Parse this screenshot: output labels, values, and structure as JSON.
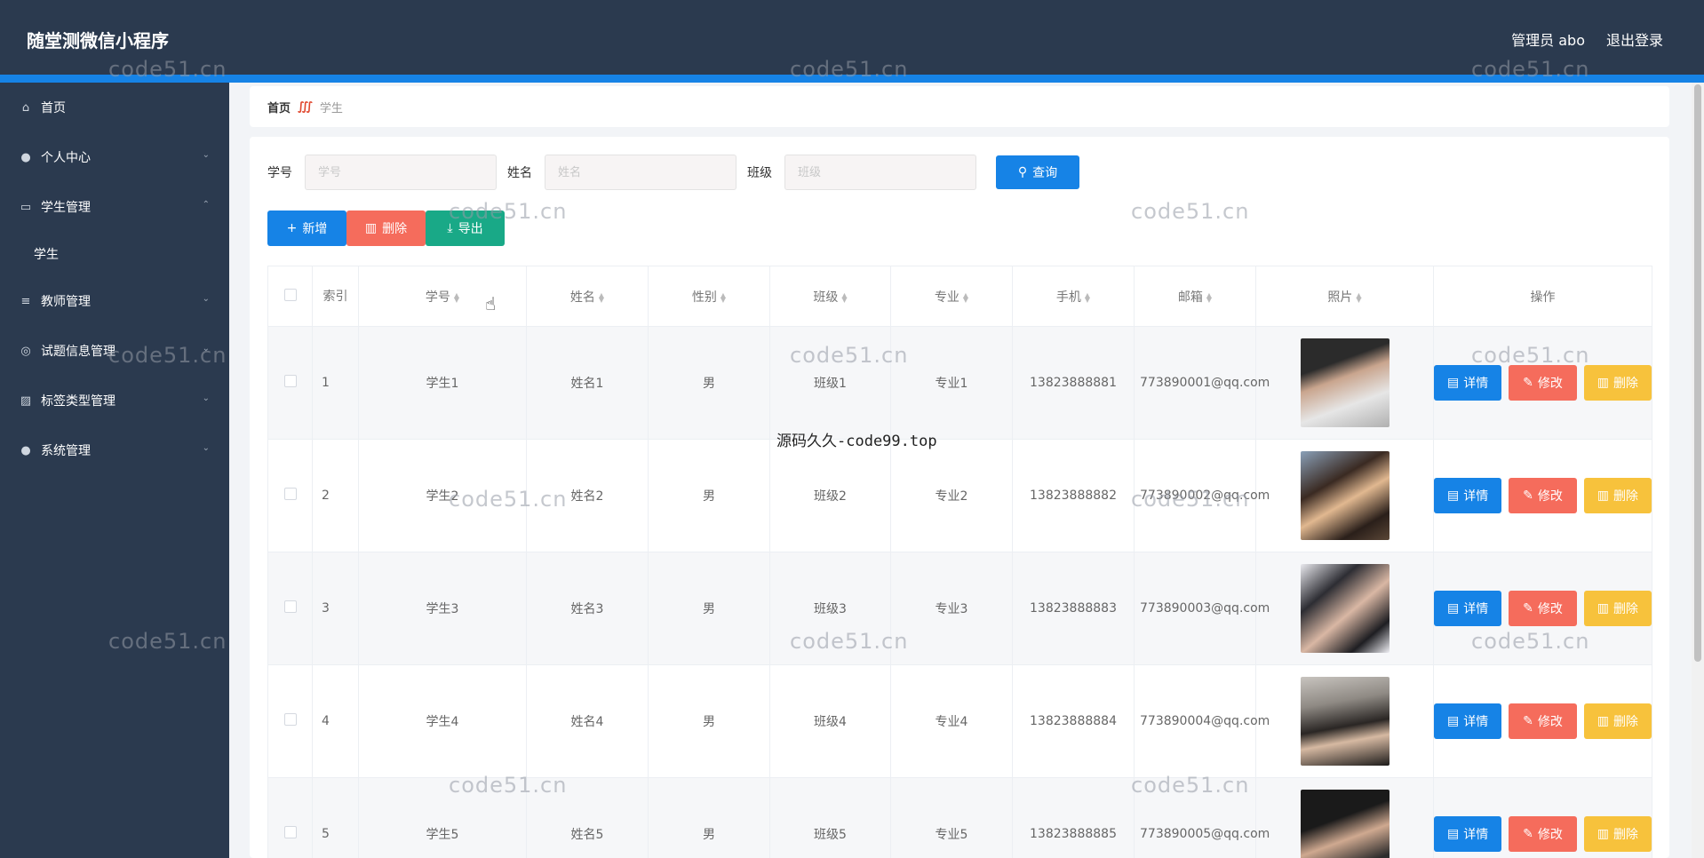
{
  "header": {
    "title": "随堂测微信小程序",
    "admin": "管理员 abo",
    "logout": "退出登录"
  },
  "sidebar": {
    "items": [
      {
        "label": "首页",
        "icon": "home-icon",
        "glyph": "⌂"
      },
      {
        "label": "个人中心",
        "icon": "user-icon",
        "glyph": "●",
        "chevron": "⌄"
      },
      {
        "label": "学生管理",
        "icon": "message-icon",
        "glyph": "▭",
        "chevron": "⌃"
      },
      {
        "label": "教师管理",
        "icon": "list-icon",
        "glyph": "≡",
        "chevron": "⌄"
      },
      {
        "label": "试题信息管理",
        "icon": "gear-icon",
        "glyph": "◎",
        "chevron": "⌄"
      },
      {
        "label": "标签类型管理",
        "icon": "chart-icon",
        "glyph": "▨",
        "chevron": "⌄"
      },
      {
        "label": "系统管理",
        "icon": "location-icon",
        "glyph": "●",
        "chevron": "⌄"
      }
    ],
    "subitem": "学生"
  },
  "breadcrumb": {
    "home": "首页",
    "sep": "∭",
    "current": "学生"
  },
  "search": {
    "id_label": "学号",
    "id_placeholder": "学号",
    "name_label": "姓名",
    "name_placeholder": "姓名",
    "class_label": "班级",
    "class_placeholder": "班级",
    "button": "查询"
  },
  "actions": {
    "add": "新增",
    "delete": "删除",
    "export": "导出"
  },
  "table": {
    "headers": {
      "index": "索引",
      "student_id": "学号",
      "name": "姓名",
      "gender": "性别",
      "class": "班级",
      "major": "专业",
      "phone": "手机",
      "email": "邮箱",
      "photo": "照片",
      "ops": "操作"
    },
    "rows": [
      {
        "index": "1",
        "student_id": "学生1",
        "name": "姓名1",
        "gender": "男",
        "class": "班级1",
        "major": "专业1",
        "phone": "13823888881",
        "email": "773890001@qq.com"
      },
      {
        "index": "2",
        "student_id": "学生2",
        "name": "姓名2",
        "gender": "男",
        "class": "班级2",
        "major": "专业2",
        "phone": "13823888882",
        "email": "773890002@qq.com"
      },
      {
        "index": "3",
        "student_id": "学生3",
        "name": "姓名3",
        "gender": "男",
        "class": "班级3",
        "major": "专业3",
        "phone": "13823888883",
        "email": "773890003@qq.com"
      },
      {
        "index": "4",
        "student_id": "学生4",
        "name": "姓名4",
        "gender": "男",
        "class": "班级4",
        "major": "专业4",
        "phone": "13823888884",
        "email": "773890004@qq.com"
      },
      {
        "index": "5",
        "student_id": "学生5",
        "name": "姓名5",
        "gender": "男",
        "class": "班级5",
        "major": "专业5",
        "phone": "13823888885",
        "email": "773890005@qq.com"
      }
    ],
    "op_detail": "详情",
    "op_edit": "修改",
    "op_delete": "删除"
  },
  "watermarks": {
    "site": "code51.cn",
    "center": "源码久久-code99.top"
  },
  "colors": {
    "header": "#2b3a4f",
    "accent": "#1683e6",
    "danger": "#f56c5c",
    "success": "#19a987",
    "warning": "#f7c23c"
  }
}
